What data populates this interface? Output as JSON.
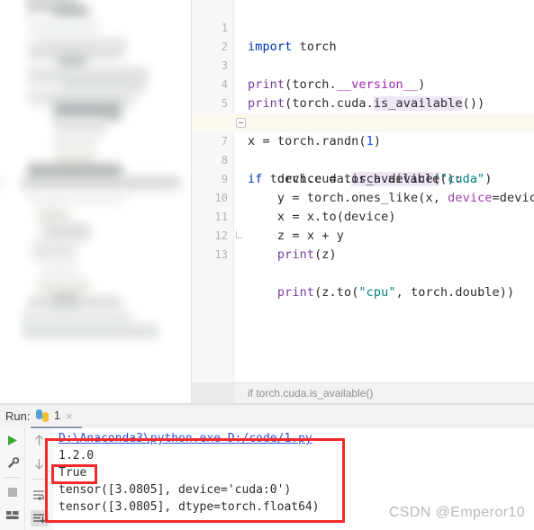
{
  "window": {
    "app": "PyCharm IDE"
  },
  "editor": {
    "file_breadcrumb": "if torch.cuda.is_available()",
    "active_line": 7,
    "lines": [
      {
        "num": "1",
        "text": "import torch"
      },
      {
        "num": "2",
        "text": ""
      },
      {
        "num": "3",
        "text": "print(torch.__version__)"
      },
      {
        "num": "4",
        "text": "print(torch.cuda.is_available())"
      },
      {
        "num": "5",
        "text": ""
      },
      {
        "num": "6",
        "text": "x = torch.randn(1)"
      },
      {
        "num": "7",
        "text": "if torch.cuda.is_available():"
      },
      {
        "num": "8",
        "text": "    device = torch.device(\"cuda\")"
      },
      {
        "num": "9",
        "text": "    y = torch.ones_like(x, device=device)"
      },
      {
        "num": "10",
        "text": "    x = x.to(device)"
      },
      {
        "num": "11",
        "text": "    z = x + y"
      },
      {
        "num": "12",
        "text": "    print(z)"
      },
      {
        "num": "13",
        "text": "    print(z.to(\"cpu\", torch.double))"
      }
    ]
  },
  "run_panel": {
    "run_label": "Run:",
    "tab_name": "1",
    "close_label": "×",
    "toolbar_left": [
      {
        "name": "run-button",
        "glyph": "▶"
      },
      {
        "name": "debug-wrench-button",
        "glyph": "🔧"
      },
      {
        "name": "stop-button",
        "glyph": "■"
      },
      {
        "name": "layout-button",
        "glyph": "▤"
      }
    ],
    "toolbar_mid": [
      {
        "name": "scroll-up-button",
        "glyph": "↑"
      },
      {
        "name": "scroll-down-button",
        "glyph": "↓"
      },
      {
        "name": "soft-wrap-button",
        "glyph": "↵"
      },
      {
        "name": "scroll-to-end-button",
        "glyph": "⇥"
      }
    ],
    "console_lines": [
      {
        "text": "D:\\Anaconda3\\python.exe D:/code/1.py",
        "link": true
      },
      {
        "text": "1.2.0",
        "link": false
      },
      {
        "text": "True",
        "link": false
      },
      {
        "text": "tensor([3.0805], device='cuda:0')",
        "link": false
      },
      {
        "text": "tensor([3.0805], dtype=torch.float64)",
        "link": false
      }
    ]
  },
  "annotations": {
    "highlight_color": "#f42a2a",
    "boxes": [
      {
        "name": "output-block-highlight"
      },
      {
        "name": "true-value-highlight"
      }
    ]
  },
  "watermark": {
    "text": "CSDN @Emperor10"
  }
}
